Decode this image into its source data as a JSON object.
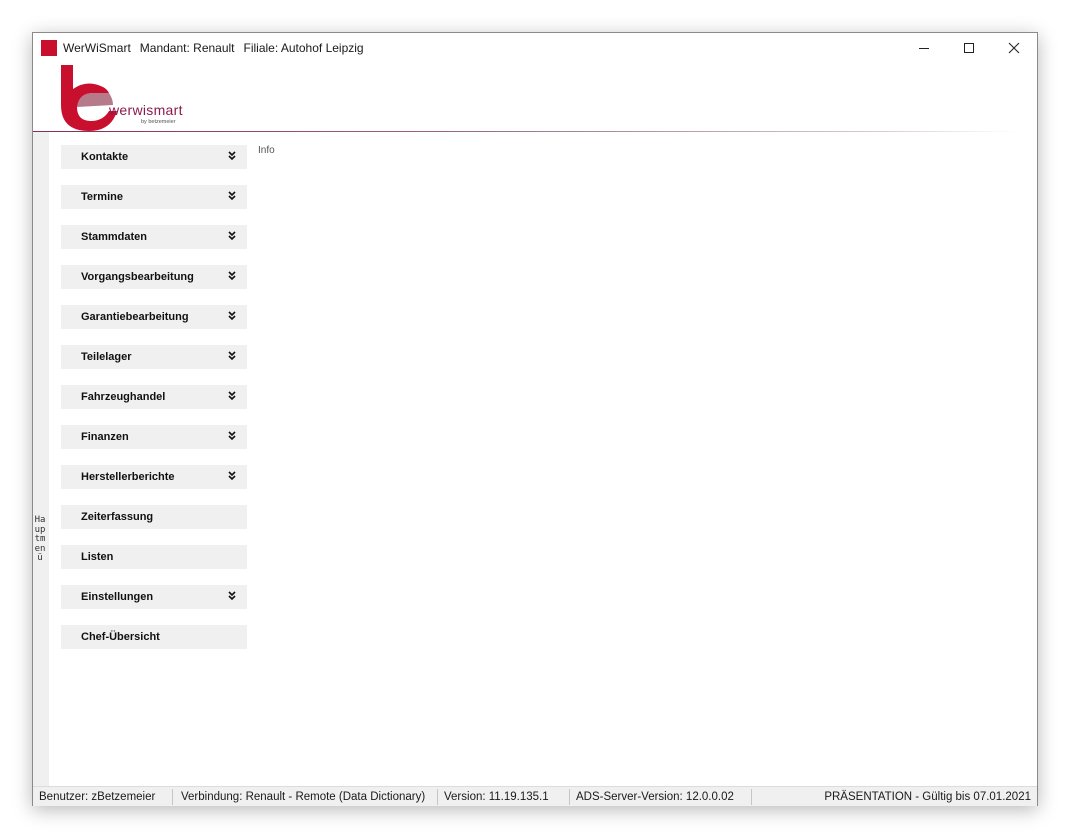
{
  "window": {
    "app_name": "WerWiSmart",
    "mandant": "Mandant: Renault",
    "filiale": "Filiale: Autohof Leipzig"
  },
  "header": {
    "logo_text": "werwismart",
    "logo_subtext": "by betzemeier",
    "info_tab": "Info"
  },
  "sidebar": {
    "label": "Hauptmenü"
  },
  "menu": {
    "items": [
      {
        "label": "Kontakte",
        "expandable": true
      },
      {
        "label": "Termine",
        "expandable": true
      },
      {
        "label": "Stammdaten",
        "expandable": true
      },
      {
        "label": "Vorgangsbearbeitung",
        "expandable": true
      },
      {
        "label": "Garantiebearbeitung",
        "expandable": true
      },
      {
        "label": "Teilelager",
        "expandable": true
      },
      {
        "label": "Fahrzeughandel",
        "expandable": true
      },
      {
        "label": "Finanzen",
        "expandable": true
      },
      {
        "label": "Herstellerberichte",
        "expandable": true
      },
      {
        "label": "Zeiterfassung",
        "expandable": false
      },
      {
        "label": "Listen",
        "expandable": false
      },
      {
        "label": "Einstellungen",
        "expandable": true
      },
      {
        "label": "Chef-Übersicht",
        "expandable": false
      }
    ]
  },
  "statusbar": {
    "benutzer": "Benutzer: zBetzemeier",
    "verbindung": "Verbindung: Renault - Remote (Data Dictionary)",
    "version": "Version: 11.19.135.1",
    "ads_version": "ADS-Server-Version: 12.0.0.02",
    "license": "PRÄSENTATION - Gültig bis 07.01.2021"
  },
  "colors": {
    "brand": "#c8102e",
    "logo_text": "#8c1a4c",
    "menu_bg": "#f0f0f0"
  }
}
